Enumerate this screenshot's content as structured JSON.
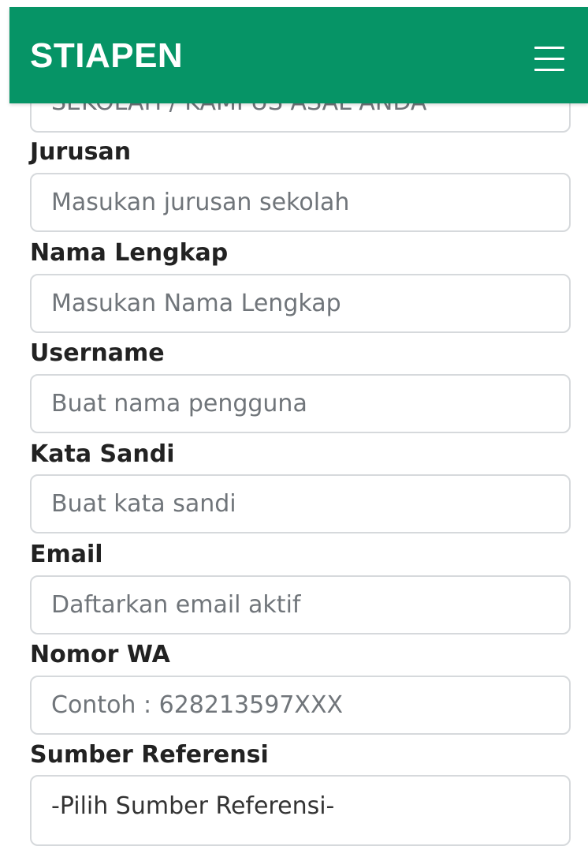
{
  "header": {
    "brand": "STIAPEN",
    "menu_icon": "hamburger-menu-icon"
  },
  "form": {
    "school_partial": "SEKOLAH / KAMPUS ASAL ANDA",
    "fields": [
      {
        "label": "Jurusan",
        "placeholder": "Masukan jurusan sekolah"
      },
      {
        "label": "Nama Lengkap",
        "placeholder": "Masukan Nama Lengkap"
      },
      {
        "label": "Username",
        "placeholder": "Buat nama pengguna"
      },
      {
        "label": "Kata Sandi",
        "placeholder": "Buat kata sandi"
      },
      {
        "label": "Email",
        "placeholder": "Daftarkan email aktif"
      },
      {
        "label": "Nomor WA",
        "placeholder": "Contoh : 628213597XXX"
      }
    ],
    "referral": {
      "label": "Sumber Referensi",
      "selected": "-Pilih Sumber Referensi-"
    }
  },
  "colors": {
    "header_bg": "#069466",
    "input_border": "#d6d9dc",
    "label_text": "#222222"
  }
}
